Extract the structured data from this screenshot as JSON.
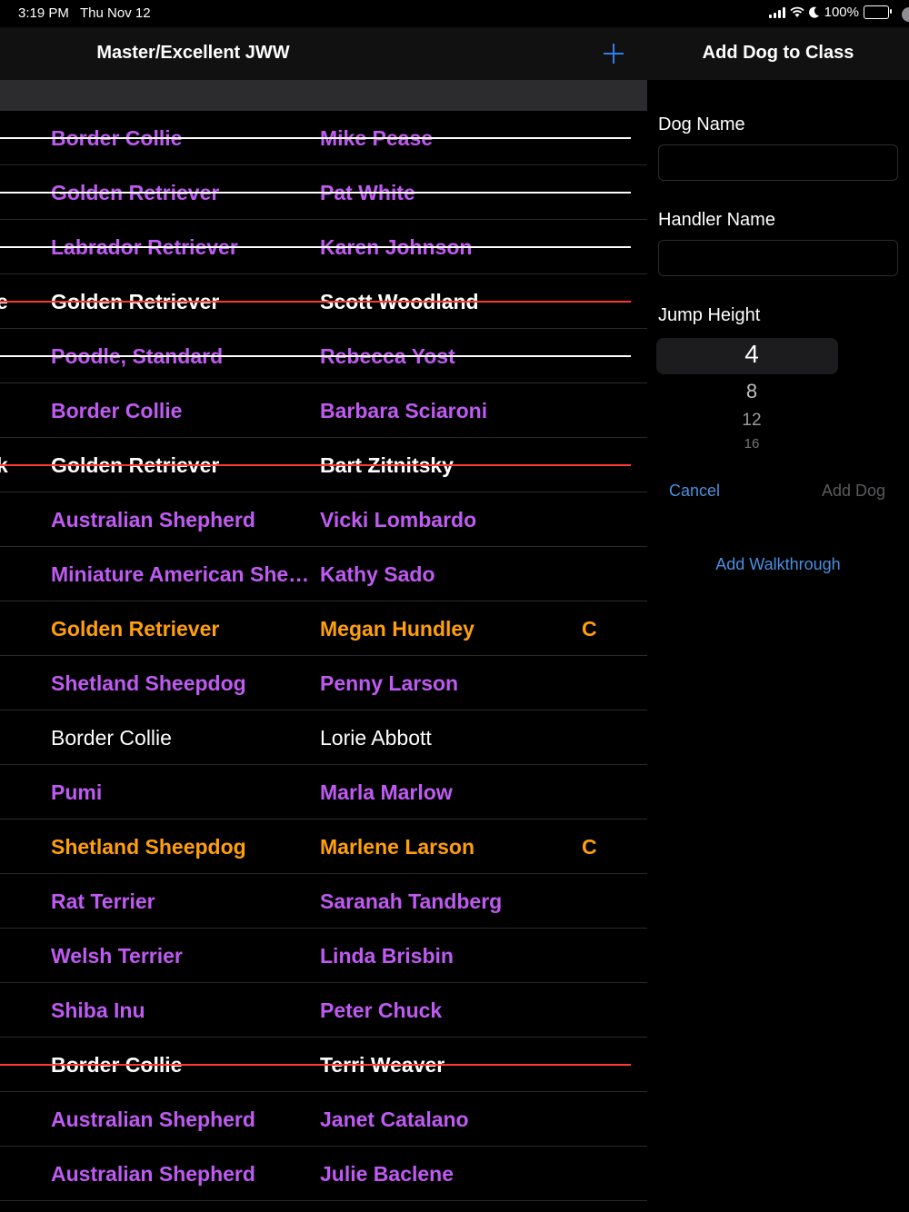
{
  "status_bar": {
    "time": "3:19 PM",
    "date": "Thu Nov 12",
    "battery": "100%",
    "icons": [
      "signal-icon",
      "wifi-icon",
      "moon-icon",
      "battery-charging-icon"
    ]
  },
  "left_nav": {
    "title": "Master/Excellent JWW",
    "add_icon": "plus-icon",
    "accent": "#2f80ed"
  },
  "rows": [
    {
      "pre": "",
      "breed": "Border Collie",
      "handler": "Mike Pease",
      "badge": "",
      "style": "purple",
      "strike": "white"
    },
    {
      "pre": "",
      "breed": "Golden Retriever",
      "handler": "Pat White",
      "badge": "",
      "style": "purple",
      "strike": "white"
    },
    {
      "pre": "",
      "breed": "Labrador Retriever",
      "handler": "Karen Johnson",
      "badge": "",
      "style": "purple",
      "strike": "white"
    },
    {
      "pre": "e",
      "breed": "Golden Retriever",
      "handler": "Scott  Woodland",
      "badge": "",
      "style": "white-bold",
      "strike": "red"
    },
    {
      "pre": "",
      "breed": "Poodle, Standard",
      "handler": "Rebecca Yost",
      "badge": "",
      "style": "purple",
      "strike": "white"
    },
    {
      "pre": "",
      "breed": "Border Collie",
      "handler": "Barbara Sciaroni",
      "badge": "",
      "style": "purple",
      "strike": ""
    },
    {
      "pre": "k",
      "breed": "Golden Retriever",
      "handler": "Bart Zitnitsky",
      "badge": "",
      "style": "white-bold",
      "strike": "red"
    },
    {
      "pre": "",
      "breed": "Australian Shepherd",
      "handler": "Vicki Lombardo",
      "badge": "",
      "style": "purple",
      "strike": ""
    },
    {
      "pre": "",
      "breed": "Miniature American Shepherd",
      "handler": "Kathy Sado",
      "badge": "",
      "style": "purple",
      "strike": ""
    },
    {
      "pre": "",
      "breed": "Golden Retriever",
      "handler": "Megan Hundley",
      "badge": "C",
      "style": "orange",
      "strike": ""
    },
    {
      "pre": "",
      "breed": "Shetland Sheepdog",
      "handler": "Penny Larson",
      "badge": "",
      "style": "purple",
      "strike": ""
    },
    {
      "pre": "",
      "breed": "Border Collie",
      "handler": "Lorie Abbott",
      "badge": "",
      "style": "white",
      "strike": ""
    },
    {
      "pre": "",
      "breed": "Pumi",
      "handler": "Marla Marlow",
      "badge": "",
      "style": "purple",
      "strike": ""
    },
    {
      "pre": "",
      "breed": "Shetland Sheepdog",
      "handler": "Marlene Larson",
      "badge": "C",
      "style": "orange",
      "strike": ""
    },
    {
      "pre": "",
      "breed": "Rat Terrier",
      "handler": "Saranah Tandberg",
      "badge": "",
      "style": "purple",
      "strike": ""
    },
    {
      "pre": "",
      "breed": "Welsh Terrier",
      "handler": "Linda Brisbin",
      "badge": "",
      "style": "purple",
      "strike": ""
    },
    {
      "pre": "",
      "breed": "Shiba Inu",
      "handler": "Peter Chuck",
      "badge": "",
      "style": "purple",
      "strike": ""
    },
    {
      "pre": "",
      "breed": "Border Collie",
      "handler": "Terri Weaver",
      "badge": "",
      "style": "white-bold",
      "strike": "red"
    },
    {
      "pre": "",
      "breed": "Australian Shepherd",
      "handler": "Janet Catalano",
      "badge": "",
      "style": "purple",
      "strike": ""
    },
    {
      "pre": "",
      "breed": "Australian Shepherd",
      "handler": "Julie Baclene",
      "badge": "",
      "style": "purple",
      "strike": ""
    }
  ],
  "colors": {
    "purple": "#bf5af2",
    "orange": "#ff9f0a",
    "strike_red": "#ff3b30",
    "strike_white": "#ffffff",
    "link_blue": "#4a90e2"
  },
  "form": {
    "title": "Add Dog to Class",
    "dog_name_label": "Dog Name",
    "dog_name_value": "",
    "handler_name_label": "Handler Name",
    "handler_name_value": "",
    "jump_height_label": "Jump Height",
    "jump_height_options": [
      "4",
      "8",
      "12",
      "16"
    ],
    "jump_height_selected": "4",
    "cancel_label": "Cancel",
    "add_dog_label": "Add Dog",
    "add_walkthrough_label": "Add Walkthrough"
  }
}
